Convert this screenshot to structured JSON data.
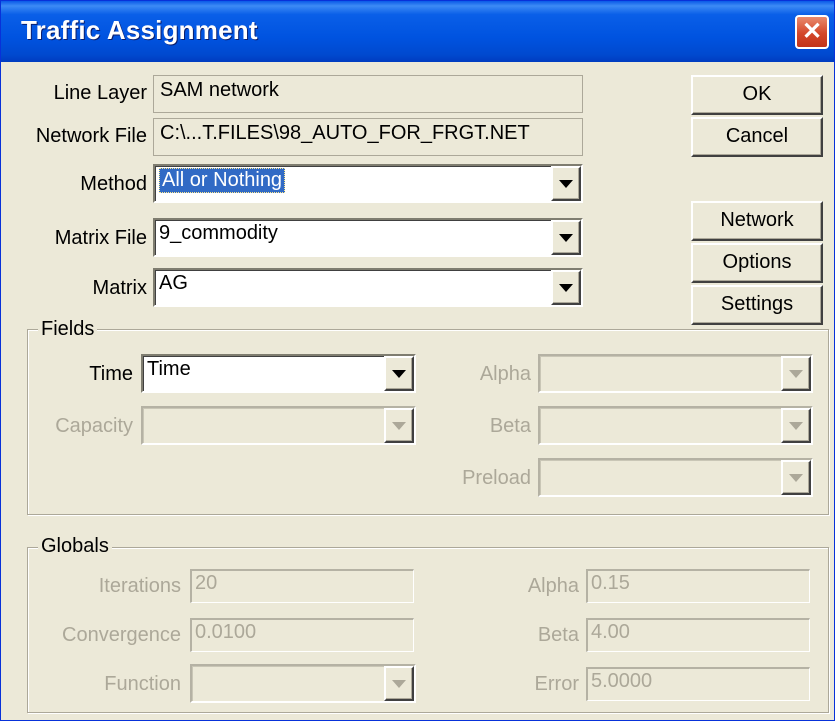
{
  "window": {
    "title": "Traffic Assignment",
    "close_glyph": "✕"
  },
  "line_layer": {
    "label": "Line Layer",
    "value": "SAM network"
  },
  "network_file": {
    "label": "Network File",
    "value": "C:\\...T.FILES\\98_AUTO_FOR_FRGT.NET"
  },
  "method": {
    "label": "Method",
    "value": "All or Nothing"
  },
  "matrix_file": {
    "label": "Matrix File",
    "value": "9_commodity"
  },
  "matrix": {
    "label": "Matrix",
    "value": "AG"
  },
  "buttons": {
    "ok": "OK",
    "cancel": "Cancel",
    "network": "Network",
    "options": "Options",
    "settings": "Settings"
  },
  "fields": {
    "legend": "Fields",
    "time": {
      "label": "Time",
      "value": "Time"
    },
    "capacity": {
      "label": "Capacity",
      "value": ""
    },
    "alpha": {
      "label": "Alpha",
      "value": ""
    },
    "beta": {
      "label": "Beta",
      "value": ""
    },
    "preload": {
      "label": "Preload",
      "value": ""
    }
  },
  "globals": {
    "legend": "Globals",
    "iterations": {
      "label": "Iterations",
      "value": "20"
    },
    "convergence": {
      "label": "Convergence",
      "value": "0.0100"
    },
    "function": {
      "label": "Function",
      "value": ""
    },
    "alpha": {
      "label": "Alpha",
      "value": "0.15"
    },
    "beta": {
      "label": "Beta",
      "value": "4.00"
    },
    "error": {
      "label": "Error",
      "value": "5.0000"
    }
  },
  "colors": {
    "titlebar": "#0053e0",
    "face": "#ece9d8",
    "selection": "#316ac5",
    "close": "#d4472a",
    "disabled_text": "#aca899"
  }
}
